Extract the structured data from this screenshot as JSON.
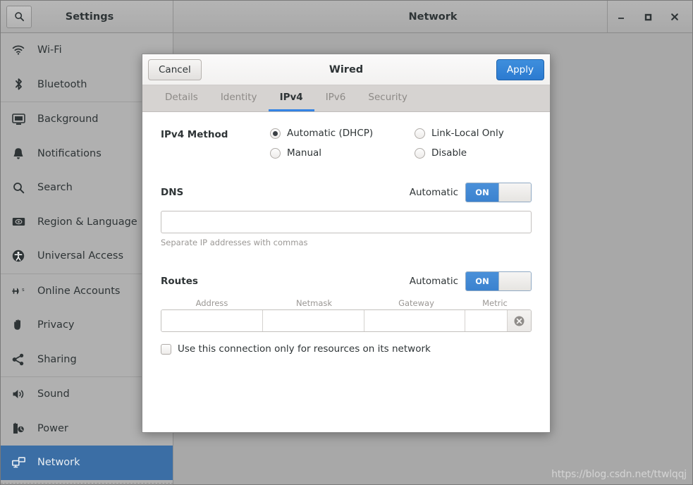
{
  "window": {
    "settings_title": "Settings",
    "panel_title": "Network",
    "search_icon": "search-icon",
    "minimize_label": "–",
    "maximize_label": "□",
    "close_label": "✕"
  },
  "sidebar": {
    "items": [
      {
        "label": "Wi-Fi",
        "icon": "wifi-icon",
        "selected": false
      },
      {
        "label": "Bluetooth",
        "icon": "bluetooth-icon",
        "selected": false
      },
      {
        "label": "Background",
        "icon": "background-icon",
        "selected": false
      },
      {
        "label": "Notifications",
        "icon": "bell-icon",
        "selected": false
      },
      {
        "label": "Search",
        "icon": "search-icon",
        "selected": false
      },
      {
        "label": "Region & Language",
        "icon": "region-language-icon",
        "selected": false
      },
      {
        "label": "Universal Access",
        "icon": "universal-access-icon",
        "selected": false
      },
      {
        "label": "Online Accounts",
        "icon": "online-accounts-icon",
        "selected": false
      },
      {
        "label": "Privacy",
        "icon": "hand-icon",
        "selected": false
      },
      {
        "label": "Sharing",
        "icon": "share-icon",
        "selected": false
      },
      {
        "label": "Sound",
        "icon": "speaker-icon",
        "selected": false
      },
      {
        "label": "Power",
        "icon": "power-plug-icon",
        "selected": false
      },
      {
        "label": "Network",
        "icon": "network-icon",
        "selected": true
      }
    ]
  },
  "background_panel": {
    "add_label": "+",
    "gear_icon": "gear-icon",
    "watermark": "https://blog.csdn.net/ttwlqqj"
  },
  "dialog": {
    "title": "Wired",
    "cancel_label": "Cancel",
    "apply_label": "Apply",
    "tabs": [
      {
        "label": "Details",
        "active": false
      },
      {
        "label": "Identity",
        "active": false
      },
      {
        "label": "IPv4",
        "active": true
      },
      {
        "label": "IPv6",
        "active": false
      },
      {
        "label": "Security",
        "active": false
      }
    ],
    "ipv4_method": {
      "label": "IPv4 Method",
      "options": [
        {
          "label": "Automatic (DHCP)",
          "selected": true
        },
        {
          "label": "Link-Local Only",
          "selected": false
        },
        {
          "label": "Manual",
          "selected": false
        },
        {
          "label": "Disable",
          "selected": false
        }
      ]
    },
    "dns": {
      "label": "DNS",
      "automatic_label": "Automatic",
      "toggle_state": "ON",
      "value": "",
      "placeholder": "",
      "hint": "Separate IP addresses with commas"
    },
    "routes": {
      "label": "Routes",
      "automatic_label": "Automatic",
      "toggle_state": "ON",
      "columns": [
        "Address",
        "Netmask",
        "Gateway",
        "Metric"
      ],
      "rows": [
        {
          "address": "",
          "netmask": "",
          "gateway": "",
          "metric": ""
        }
      ],
      "delete_icon": "delete-circle-icon"
    },
    "restrict_checkbox": {
      "label": "Use this connection only for resources on its network",
      "checked": false
    }
  },
  "colors": {
    "accent_blue": "#3584e4",
    "toggle_blue": "#4a90d9",
    "selection_blue": "#3b6ea5",
    "apply_blue": "#2b7ad0"
  }
}
